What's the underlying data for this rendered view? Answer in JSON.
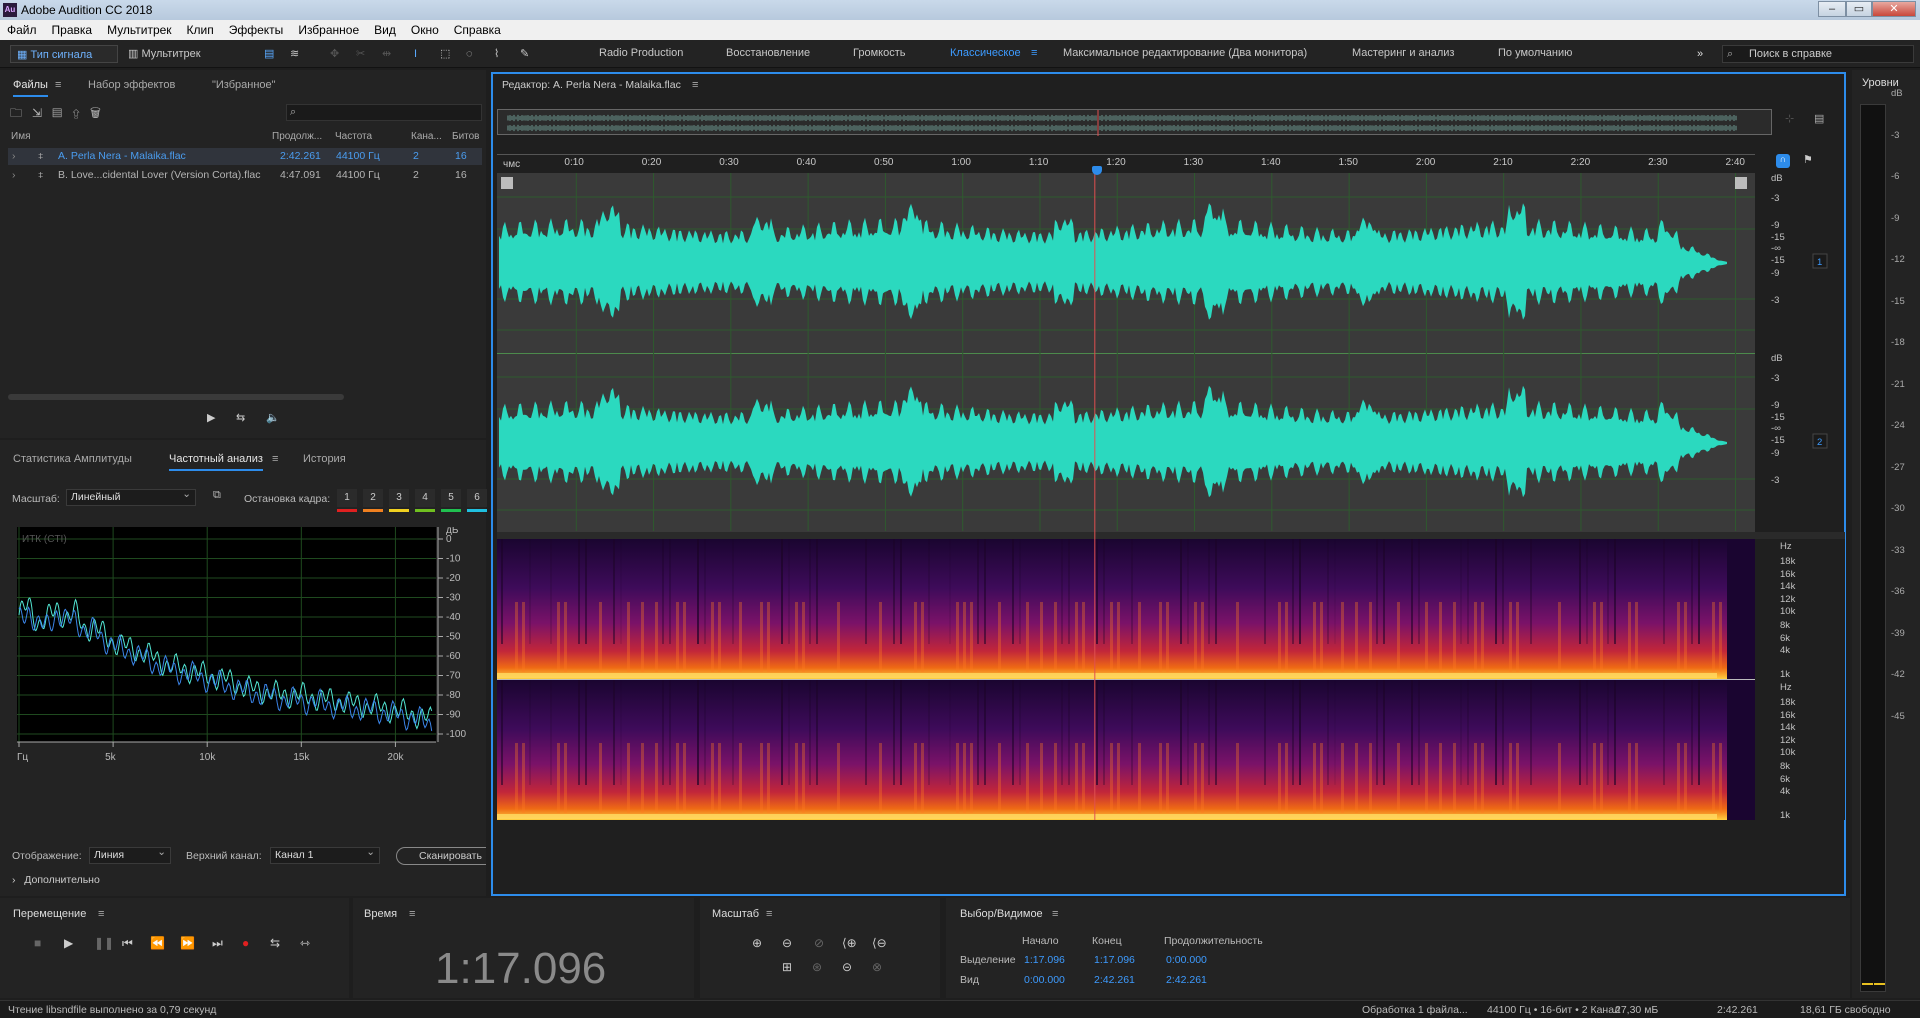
{
  "window": {
    "title": "Adobe Audition CC 2018",
    "app_icon": "Au"
  },
  "menu": [
    "Файл",
    "Правка",
    "Мультитрек",
    "Клип",
    "Эффекты",
    "Избранное",
    "Вид",
    "Окно",
    "Справка"
  ],
  "toolbar": {
    "waveform_label": "Тип сигнала",
    "multitrack_label": "Мультитрек",
    "workspaces": [
      "Radio Production",
      "Восстановление",
      "Громкость",
      "Классическое",
      "Максимальное редактирование (Два монитора)",
      "Мастеринг и анализ",
      "По умолчанию"
    ],
    "active_workspace": "Классическое",
    "help_search_placeholder": "Поиск в справке",
    "overflow": "»"
  },
  "files_panel": {
    "tabs": [
      "Файлы",
      "Набор эффектов",
      "\"Избранное\""
    ],
    "search_placeholder": "",
    "columns": [
      "Имя",
      "Продолж...",
      "Частота",
      "Кана...",
      "Битов"
    ],
    "rows": [
      {
        "name": "A. Perla Nera - Malaika.flac",
        "duration": "2:42.261",
        "rate": "44100 Гц",
        "channels": "2",
        "bits": "16"
      },
      {
        "name": "B. Love...cidental Lover (Version Corta).flac",
        "duration": "4:47.091",
        "rate": "44100 Гц",
        "channels": "2",
        "bits": "16"
      }
    ]
  },
  "analysis_panel": {
    "tabs": [
      "Статистика Амплитуды",
      "Частотный анализ",
      "История"
    ],
    "scale_label": "Масштаб:",
    "scale_value": "Линейный",
    "freeze_label": "Остановка кадра:",
    "freeze_slots": [
      "1",
      "2",
      "3",
      "4",
      "5",
      "6"
    ],
    "freeze_colors": [
      "#e02020",
      "#f08020",
      "#f0d020",
      "#70c020",
      "#20c050",
      "#20c0e0"
    ],
    "plot_caption": "ИТК (CTI)",
    "display_label": "Отображение:",
    "display_value": "Линия",
    "channel_label": "Верхний канал:",
    "channel_value": "Канал 1",
    "scan_button": "Сканировать",
    "advanced_label": "Дополнительно"
  },
  "chart_data": {
    "type": "line",
    "title": "",
    "xlabel": "",
    "ylabel": "",
    "x_ticks": [
      "Гц",
      "5k",
      "10k",
      "15k",
      "20k"
    ],
    "y_ticks": [
      "дБ",
      "0",
      "-10",
      "-20",
      "-30",
      "-40",
      "-50",
      "-60",
      "-70",
      "-80",
      "-90",
      "-100"
    ],
    "ylim": [
      -100,
      0
    ],
    "xlim": [
      0,
      22050
    ],
    "series": [
      {
        "color": "#52e6d3",
        "x": [
          0,
          500,
          1000,
          1500,
          2000,
          2500,
          3000,
          3500,
          4000,
          4500,
          5000,
          6000,
          7000,
          8000,
          9000,
          10000,
          11000,
          12000,
          13000,
          14000,
          15000,
          16000,
          17000,
          18000,
          19000,
          20000,
          21000,
          22000
        ],
        "values": [
          -39,
          -34,
          -43,
          -41,
          -36,
          -40,
          -38,
          -46,
          -45,
          -49,
          -53,
          -56,
          -60,
          -65,
          -67,
          -70,
          -72,
          -76,
          -78,
          -80,
          -80,
          -82,
          -83,
          -85,
          -86,
          -88,
          -90,
          -93
        ]
      },
      {
        "color": "#3b84e8",
        "x": [
          0,
          500,
          1000,
          1500,
          2000,
          2500,
          3000,
          3500,
          4000,
          4500,
          5000,
          6000,
          7000,
          8000,
          9000,
          10000,
          11000,
          12000,
          13000,
          14000,
          15000,
          16000,
          17000,
          18000,
          19000,
          20000,
          21000,
          22000
        ],
        "values": [
          -42,
          -36,
          -45,
          -44,
          -38,
          -43,
          -40,
          -48,
          -47,
          -51,
          -55,
          -58,
          -63,
          -67,
          -69,
          -72,
          -75,
          -78,
          -80,
          -82,
          -83,
          -84,
          -86,
          -87,
          -88,
          -90,
          -92,
          -95
        ]
      }
    ]
  },
  "editor": {
    "title": "Редактор: A. Perla Nera - Malaika.flac",
    "ruler_unit": "чмс",
    "ruler_ticks": [
      "0:10",
      "0:20",
      "0:30",
      "0:40",
      "0:50",
      "1:00",
      "1:10",
      "1:20",
      "1:30",
      "1:40",
      "1:50",
      "2:00",
      "2:10",
      "2:20",
      "2:30",
      "2:40"
    ],
    "db_labels_ch1": [
      "dB",
      "-3",
      "-9",
      "-15",
      "-∞",
      "-15",
      "-9",
      "-3"
    ],
    "db_labels_ch2": [
      "dB",
      "-3",
      "-9",
      "-15",
      "-∞",
      "-15",
      "-9",
      "-3"
    ],
    "channel_numbers": [
      "1",
      "2"
    ],
    "hz_labels": [
      "Hz",
      "18k",
      "16k",
      "14k",
      "12k",
      "10k",
      "8k",
      "6k",
      "4k",
      "1k"
    ],
    "waveform_color": "#2bd9bf",
    "playhead_color": "#e05050"
  },
  "levels_panel": {
    "title": "Уровни",
    "ticks": [
      "dB",
      "-3",
      "-6",
      "-9",
      "-12",
      "-15",
      "-18",
      "-21",
      "-24",
      "-27",
      "-30",
      "-33",
      "-36",
      "-39",
      "-42",
      "-45"
    ]
  },
  "transport": {
    "title": "Перемещение",
    "buttons": [
      "stop",
      "play",
      "pause",
      "to-start",
      "rewind",
      "fast-forward",
      "to-end",
      "record",
      "loop",
      "skip-selection"
    ]
  },
  "time_panel": {
    "title": "Время",
    "value": "1:17.096"
  },
  "zoom_panel": {
    "title": "Масштаб"
  },
  "selection_panel": {
    "title": "Выбор/Видимое",
    "columns": [
      "Начало",
      "Конец",
      "Продолжительность"
    ],
    "rows": [
      {
        "label": "Выделение",
        "start": "1:17.096",
        "end": "1:17.096",
        "duration": "0:00.000"
      },
      {
        "label": "Вид",
        "start": "0:00.000",
        "end": "2:42.261",
        "duration": "2:42.261"
      }
    ]
  },
  "status": {
    "message": "Чтение libsndfile выполнено за 0,79 секунд",
    "processing": "Обработка 1 файла...",
    "format": "44100 Гц • 16-бит • 2 Канал",
    "size": "27,30 мБ",
    "duration": "2:42.261",
    "free": "18,61 ГБ свободно"
  }
}
